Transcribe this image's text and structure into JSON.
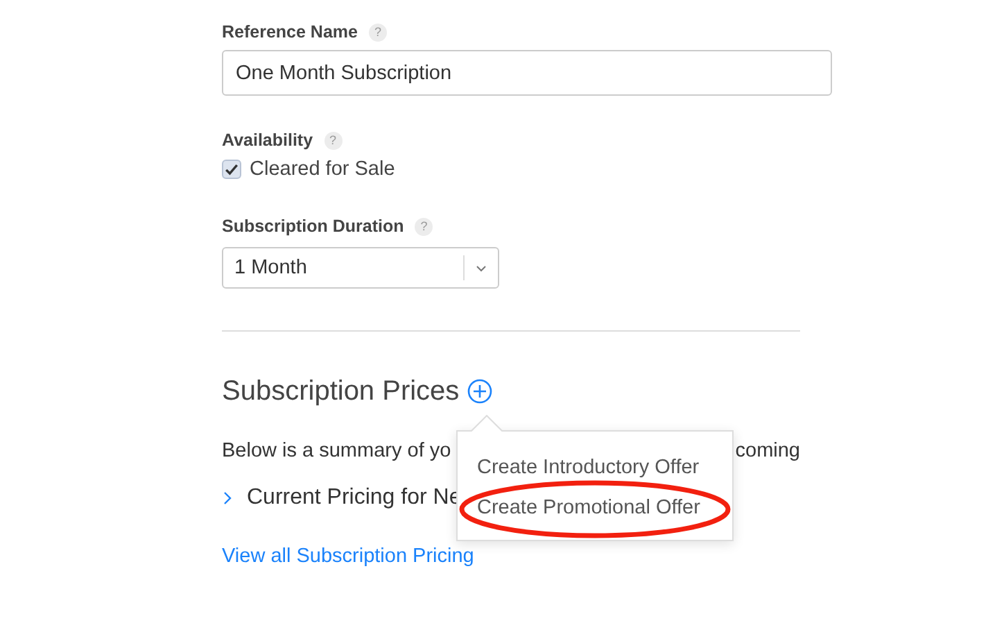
{
  "reference_name": {
    "label": "Reference Name",
    "help": "?",
    "value": "One Month Subscription"
  },
  "availability": {
    "label": "Availability",
    "help": "?",
    "option": {
      "label": "Cleared for Sale",
      "checked": true
    }
  },
  "subscription_duration": {
    "label": "Subscription Duration",
    "help": "?",
    "value": "1 Month"
  },
  "subscription_prices": {
    "title": "Subscription Prices",
    "summary_start": "Below is a summary of yo",
    "summary_end": "coming",
    "pricing_row": {
      "label": "Current Pricing for Ne",
      "expanded": false
    },
    "link": "View all Subscription Pricing"
  },
  "popup_menu": {
    "items": [
      {
        "label": "Create Introductory Offer",
        "highlighted": false
      },
      {
        "label": "Create Promotional Offer",
        "highlighted": true
      }
    ]
  }
}
